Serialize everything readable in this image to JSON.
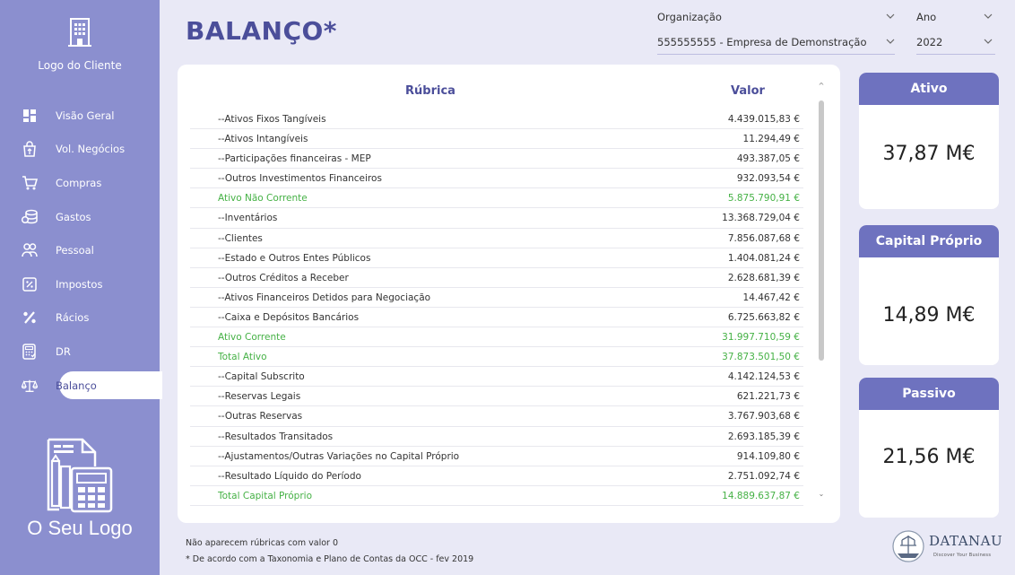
{
  "sidebar": {
    "client_logo_label": "Logo do Cliente",
    "items": [
      {
        "label": "Visão Geral",
        "icon": "dashboard-icon"
      },
      {
        "label": "Vol. Negócios",
        "icon": "shopping-bag-icon"
      },
      {
        "label": "Compras",
        "icon": "cart-icon"
      },
      {
        "label": "Gastos",
        "icon": "coins-icon"
      },
      {
        "label": "Pessoal",
        "icon": "people-icon"
      },
      {
        "label": "Impostos",
        "icon": "tax-receipt-icon"
      },
      {
        "label": "Rácios",
        "icon": "percent-icon"
      },
      {
        "label": "DR",
        "icon": "calculator-icon"
      },
      {
        "label": "Balanço",
        "icon": "scale-icon",
        "active": true
      }
    ],
    "brand_logo_label": "O Seu Logo"
  },
  "header": {
    "title": "BALANÇO*",
    "org_label": "Organização",
    "org_value": "555555555 - Empresa de Demonstração",
    "year_label": "Ano",
    "year_value": "2022"
  },
  "table": {
    "col_rubrica": "Rúbrica",
    "col_valor": "Valor",
    "rows": [
      {
        "label": "--Ativos Fixos Tangíveis",
        "value": "4.439.015,83 €",
        "total": false
      },
      {
        "label": "--Ativos Intangíveis",
        "value": "11.294,49 €",
        "total": false
      },
      {
        "label": "--Participações financeiras - MEP",
        "value": "493.387,05 €",
        "total": false
      },
      {
        "label": "--Outros Investimentos Financeiros",
        "value": "932.093,54 €",
        "total": false
      },
      {
        "label": "Ativo Não Corrente",
        "value": "5.875.790,91 €",
        "total": true
      },
      {
        "label": "--Inventários",
        "value": "13.368.729,04 €",
        "total": false
      },
      {
        "label": "--Clientes",
        "value": "7.856.087,68 €",
        "total": false
      },
      {
        "label": "--Estado e Outros Entes Públicos",
        "value": "1.404.081,24 €",
        "total": false
      },
      {
        "label": "--Outros Créditos a Receber",
        "value": "2.628.681,39 €",
        "total": false
      },
      {
        "label": "--Ativos Financeiros Detidos para Negociação",
        "value": "14.467,42 €",
        "total": false
      },
      {
        "label": "--Caixa e Depósitos Bancários",
        "value": "6.725.663,82 €",
        "total": false
      },
      {
        "label": "Ativo Corrente",
        "value": "31.997.710,59 €",
        "total": true
      },
      {
        "label": "Total Ativo",
        "value": "37.873.501,50 €",
        "total": true
      },
      {
        "label": "--Capital Subscrito",
        "value": "4.142.124,53 €",
        "total": false
      },
      {
        "label": "--Reservas Legais",
        "value": "621.221,73 €",
        "total": false
      },
      {
        "label": "--Outras Reservas",
        "value": "3.767.903,68 €",
        "total": false
      },
      {
        "label": "--Resultados Transitados",
        "value": "2.693.185,39 €",
        "total": false
      },
      {
        "label": "--Ajustamentos/Outras Variações no Capital Próprio",
        "value": "914.109,80 €",
        "total": false
      },
      {
        "label": "--Resultado Líquido do Período",
        "value": "2.751.092,74 €",
        "total": false
      },
      {
        "label": "Total Capital Próprio",
        "value": "14.889.637,87 €",
        "total": true
      }
    ]
  },
  "kpis": {
    "ativo": {
      "label": "Ativo",
      "value": "37,87 M€"
    },
    "capital": {
      "label": "Capital Próprio",
      "value": "14,89 M€"
    },
    "passivo": {
      "label": "Passivo",
      "value": "21,56 M€"
    }
  },
  "footer": {
    "note1": "Não aparecem rúbricas com valor 0",
    "note2": "* De acordo com a Taxonomia e Plano de Contas da OCC - fev 2019",
    "datanau_name": "DATANAU",
    "datanau_tag": "Discover Your Business"
  },
  "colors": {
    "sidebar": "#8b8fcf",
    "accent": "#4b4e9a",
    "kpi_header": "#6e72bf",
    "total_text": "#45b145",
    "background": "#e9e9f6"
  }
}
